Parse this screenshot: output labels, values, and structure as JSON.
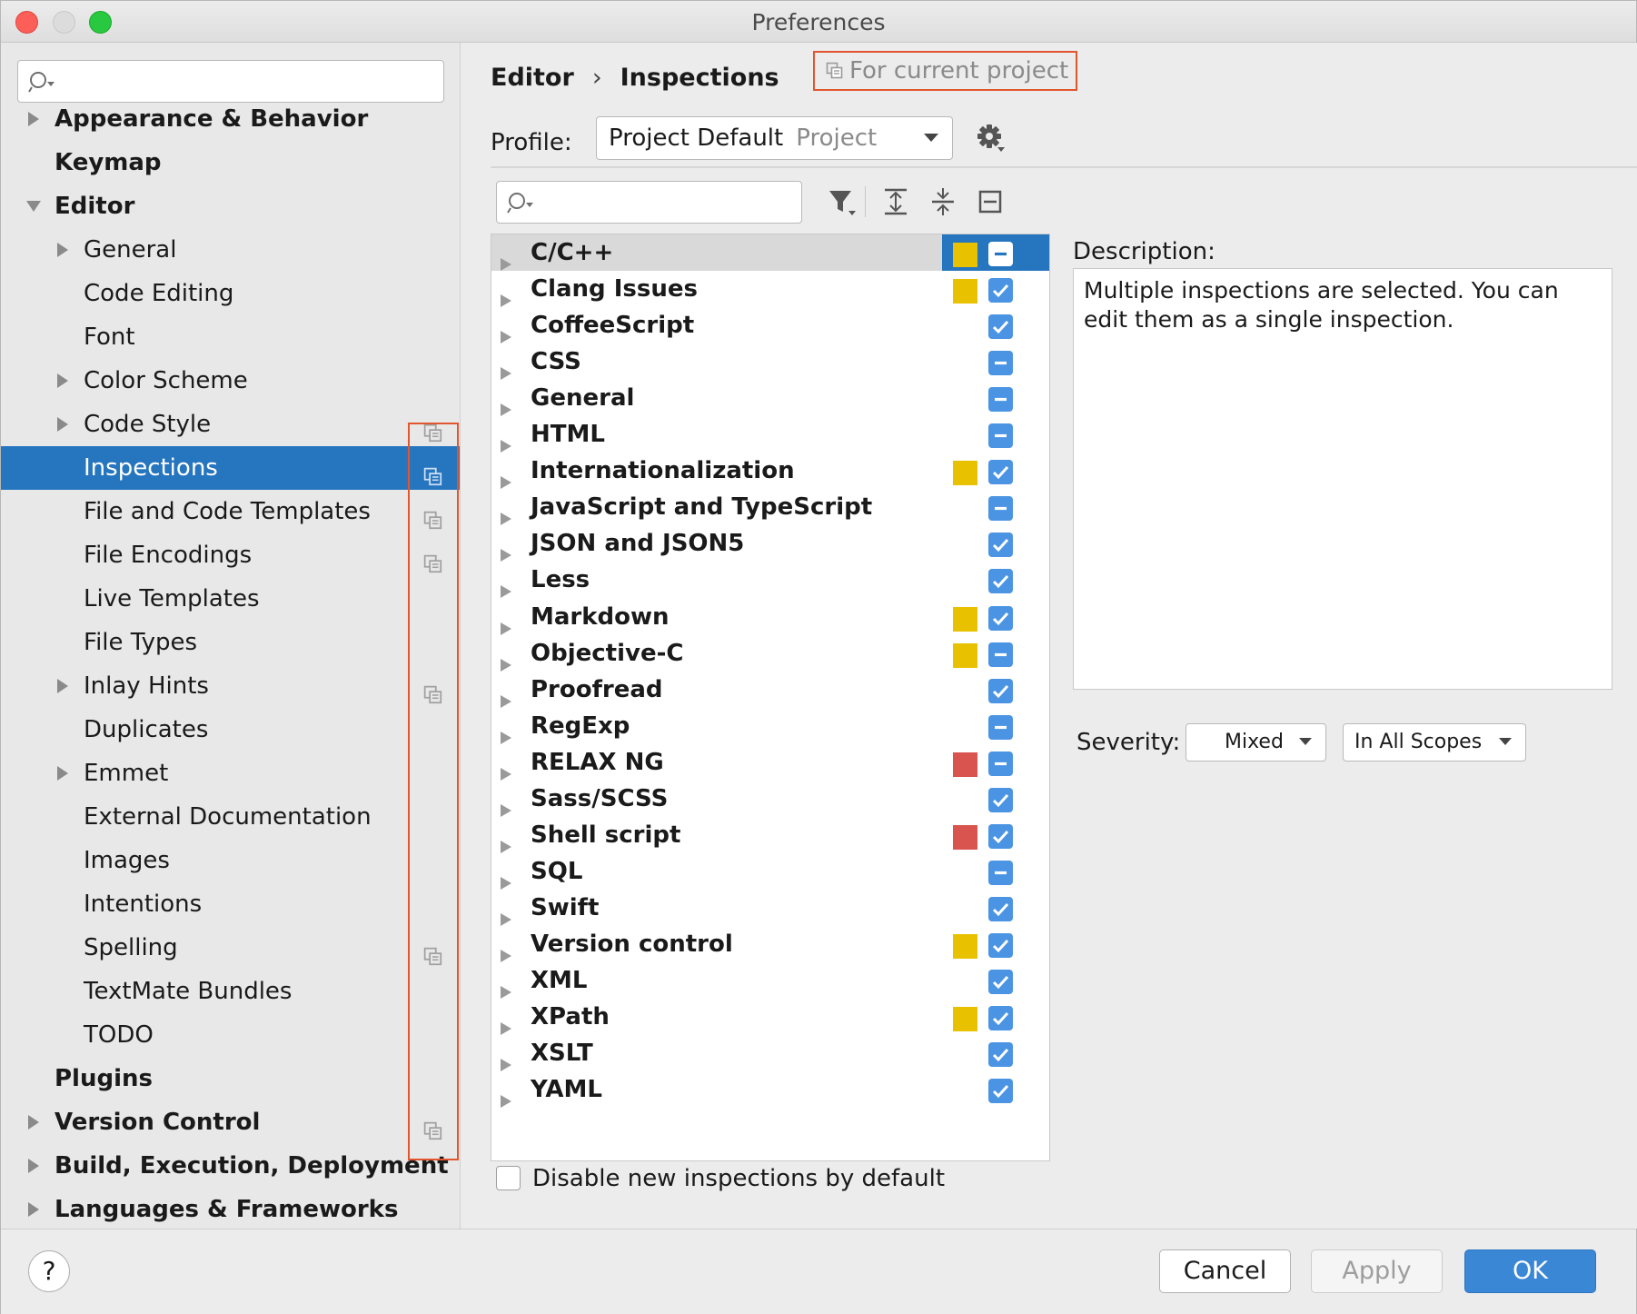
{
  "window": {
    "title": "Preferences"
  },
  "sidebar": {
    "search": {
      "placeholder": ""
    },
    "items": [
      {
        "label": "Appearance & Behavior",
        "level": 0,
        "expandable": true,
        "expanded": false,
        "project": false,
        "selected": false
      },
      {
        "label": "Keymap",
        "level": 0,
        "expandable": false,
        "expanded": false,
        "project": false,
        "selected": false
      },
      {
        "label": "Editor",
        "level": 0,
        "expandable": true,
        "expanded": true,
        "project": false,
        "selected": false
      },
      {
        "label": "General",
        "level": 1,
        "expandable": true,
        "expanded": false,
        "project": false,
        "selected": false
      },
      {
        "label": "Code Editing",
        "level": 1,
        "expandable": false,
        "expanded": false,
        "project": false,
        "selected": false
      },
      {
        "label": "Font",
        "level": 1,
        "expandable": false,
        "expanded": false,
        "project": false,
        "selected": false
      },
      {
        "label": "Color Scheme",
        "level": 1,
        "expandable": true,
        "expanded": false,
        "project": false,
        "selected": false
      },
      {
        "label": "Code Style",
        "level": 1,
        "expandable": true,
        "expanded": false,
        "project": true,
        "selected": false
      },
      {
        "label": "Inspections",
        "level": 1,
        "expandable": false,
        "expanded": false,
        "project": true,
        "selected": true
      },
      {
        "label": "File and Code Templates",
        "level": 1,
        "expandable": false,
        "expanded": false,
        "project": true,
        "selected": false
      },
      {
        "label": "File Encodings",
        "level": 1,
        "expandable": false,
        "expanded": false,
        "project": true,
        "selected": false
      },
      {
        "label": "Live Templates",
        "level": 1,
        "expandable": false,
        "expanded": false,
        "project": false,
        "selected": false
      },
      {
        "label": "File Types",
        "level": 1,
        "expandable": false,
        "expanded": false,
        "project": false,
        "selected": false
      },
      {
        "label": "Inlay Hints",
        "level": 1,
        "expandable": true,
        "expanded": false,
        "project": true,
        "selected": false
      },
      {
        "label": "Duplicates",
        "level": 1,
        "expandable": false,
        "expanded": false,
        "project": false,
        "selected": false
      },
      {
        "label": "Emmet",
        "level": 1,
        "expandable": true,
        "expanded": false,
        "project": false,
        "selected": false
      },
      {
        "label": "External Documentation",
        "level": 1,
        "expandable": false,
        "expanded": false,
        "project": false,
        "selected": false
      },
      {
        "label": "Images",
        "level": 1,
        "expandable": false,
        "expanded": false,
        "project": false,
        "selected": false
      },
      {
        "label": "Intentions",
        "level": 1,
        "expandable": false,
        "expanded": false,
        "project": false,
        "selected": false
      },
      {
        "label": "Spelling",
        "level": 1,
        "expandable": false,
        "expanded": false,
        "project": true,
        "selected": false
      },
      {
        "label": "TextMate Bundles",
        "level": 1,
        "expandable": false,
        "expanded": false,
        "project": false,
        "selected": false
      },
      {
        "label": "TODO",
        "level": 1,
        "expandable": false,
        "expanded": false,
        "project": false,
        "selected": false
      },
      {
        "label": "Plugins",
        "level": 0,
        "expandable": false,
        "expanded": false,
        "project": false,
        "selected": false
      },
      {
        "label": "Version Control",
        "level": 0,
        "expandable": true,
        "expanded": false,
        "project": true,
        "selected": false
      },
      {
        "label": "Build, Execution, Deployment",
        "level": 0,
        "expandable": true,
        "expanded": false,
        "project": false,
        "selected": false
      },
      {
        "label": "Languages & Frameworks",
        "level": 0,
        "expandable": true,
        "expanded": false,
        "project": false,
        "selected": false
      }
    ]
  },
  "main": {
    "breadcrumb": {
      "parent": "Editor",
      "separator": "›",
      "current": "Inspections"
    },
    "scope_hint": "For current project",
    "profile": {
      "label": "Profile:",
      "value": "Project Default",
      "sub": "Project"
    },
    "inspections": [
      {
        "name": "C/C++",
        "severity_color": "#e8c200",
        "state": "mixed",
        "selected": true
      },
      {
        "name": "Clang Issues",
        "severity_color": "#e8c200",
        "state": "checked",
        "selected": false
      },
      {
        "name": "CoffeeScript",
        "severity_color": "",
        "state": "checked",
        "selected": false
      },
      {
        "name": "CSS",
        "severity_color": "",
        "state": "mixed",
        "selected": false
      },
      {
        "name": "General",
        "severity_color": "",
        "state": "mixed",
        "selected": false
      },
      {
        "name": "HTML",
        "severity_color": "",
        "state": "mixed",
        "selected": false
      },
      {
        "name": "Internationalization",
        "severity_color": "#e8c200",
        "state": "checked",
        "selected": false
      },
      {
        "name": "JavaScript and TypeScript",
        "severity_color": "",
        "state": "mixed",
        "selected": false
      },
      {
        "name": "JSON and JSON5",
        "severity_color": "",
        "state": "checked",
        "selected": false
      },
      {
        "name": "Less",
        "severity_color": "",
        "state": "checked",
        "selected": false
      },
      {
        "name": "Markdown",
        "severity_color": "#e8c200",
        "state": "checked",
        "selected": false
      },
      {
        "name": "Objective-C",
        "severity_color": "#e8c200",
        "state": "mixed",
        "selected": false
      },
      {
        "name": "Proofread",
        "severity_color": "",
        "state": "checked",
        "selected": false
      },
      {
        "name": "RegExp",
        "severity_color": "",
        "state": "mixed",
        "selected": false
      },
      {
        "name": "RELAX NG",
        "severity_color": "#d9534f",
        "state": "mixed",
        "selected": false
      },
      {
        "name": "Sass/SCSS",
        "severity_color": "",
        "state": "checked",
        "selected": false
      },
      {
        "name": "Shell script",
        "severity_color": "#d9534f",
        "state": "checked",
        "selected": false
      },
      {
        "name": "SQL",
        "severity_color": "",
        "state": "mixed",
        "selected": false
      },
      {
        "name": "Swift",
        "severity_color": "",
        "state": "checked",
        "selected": false
      },
      {
        "name": "Version control",
        "severity_color": "#e8c200",
        "state": "checked",
        "selected": false
      },
      {
        "name": "XML",
        "severity_color": "",
        "state": "checked",
        "selected": false
      },
      {
        "name": "XPath",
        "severity_color": "#e8c200",
        "state": "checked",
        "selected": false
      },
      {
        "name": "XSLT",
        "severity_color": "",
        "state": "checked",
        "selected": false
      },
      {
        "name": "YAML",
        "severity_color": "",
        "state": "checked",
        "selected": false
      }
    ],
    "disable_new": {
      "label": "Disable new inspections by default",
      "checked": false
    },
    "description": {
      "label": "Description:",
      "text": "Multiple inspections are selected. You can edit them as a single inspection."
    },
    "severity": {
      "label": "Severity:",
      "value": "Mixed",
      "scope": "In All Scopes"
    }
  },
  "footer": {
    "help": "?",
    "cancel": "Cancel",
    "apply": "Apply",
    "ok": "OK"
  },
  "colors": {
    "accent": "#2675bf",
    "checkbox": "#4a94e3",
    "highlight_box": "#e2552e",
    "ok_button": "#3a87d6"
  }
}
